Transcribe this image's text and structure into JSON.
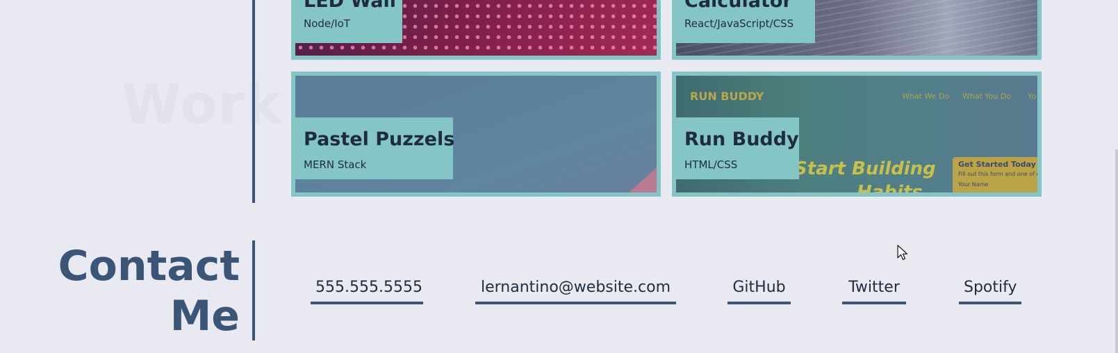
{
  "work_section": {
    "faded_heading": "Work"
  },
  "projects": [
    {
      "title": "LED Wall",
      "tech": "Node/IoT"
    },
    {
      "title": "Calculator",
      "tech": "React/JavaScript/CSS"
    },
    {
      "title": "Pastel Puzzels",
      "tech": "MERN Stack"
    },
    {
      "title": "Run Buddy",
      "tech": "HTML/CSS",
      "preview": {
        "logo": "RUN BUDDY",
        "nav": [
          "What We Do",
          "What You Do",
          "Yo"
        ],
        "hero_line1": "Start Building",
        "hero_line2": "Habits",
        "form_title": "Get Started Today",
        "form_sub": "Fill out this form and one of o",
        "form_field": "Your Name"
      }
    }
  ],
  "contact": {
    "heading_line1": "Contact",
    "heading_line2": "Me",
    "links": [
      {
        "label": "555.555.5555"
      },
      {
        "label": "lernantino@website.com"
      },
      {
        "label": "GitHub"
      },
      {
        "label": "Twitter"
      },
      {
        "label": "Spotify"
      }
    ]
  },
  "colors": {
    "background": "#e9e9f2",
    "accent_teal": "#84c5c6",
    "primary_navy": "#3b5576",
    "text_dark": "#1f2c3e"
  }
}
